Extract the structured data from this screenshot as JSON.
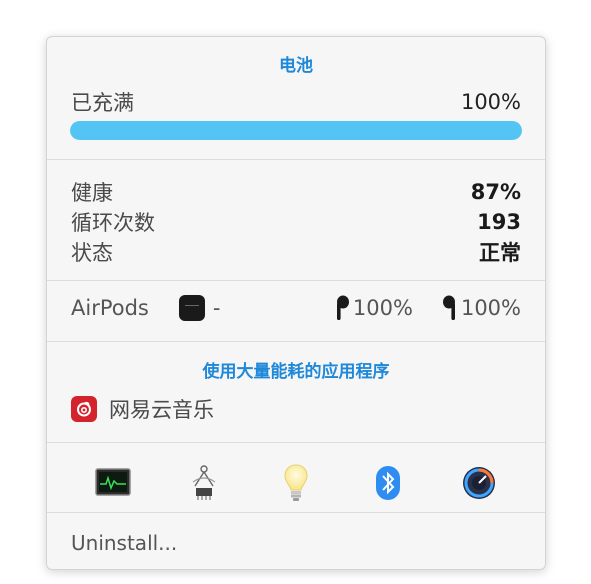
{
  "battery": {
    "title": "电池",
    "status_label": "已充满",
    "charge_percent": "100%",
    "charge_level": 1.0
  },
  "health": {
    "rows": [
      {
        "label": "健康",
        "value": "87%"
      },
      {
        "label": "循环次数",
        "value": "193"
      },
      {
        "label": "状态",
        "value": "正常"
      }
    ]
  },
  "airpods": {
    "label": "AirPods",
    "case_value": "-",
    "left_value": "100%",
    "right_value": "100%"
  },
  "energy": {
    "title": "使用大量能耗的应用程序",
    "apps": [
      {
        "name": "网易云音乐",
        "icon": "netease-music-icon"
      }
    ]
  },
  "toolbar": {
    "icons": [
      "activity-monitor-icon",
      "system-information-icon",
      "lightbulb-icon",
      "bluetooth-icon",
      "istat-menus-icon"
    ]
  },
  "footer": {
    "uninstall_label": "Uninstall..."
  },
  "colors": {
    "accent": "#1e88d9",
    "battery_fill": "#54c4f4",
    "netease_red": "#d4232c"
  }
}
